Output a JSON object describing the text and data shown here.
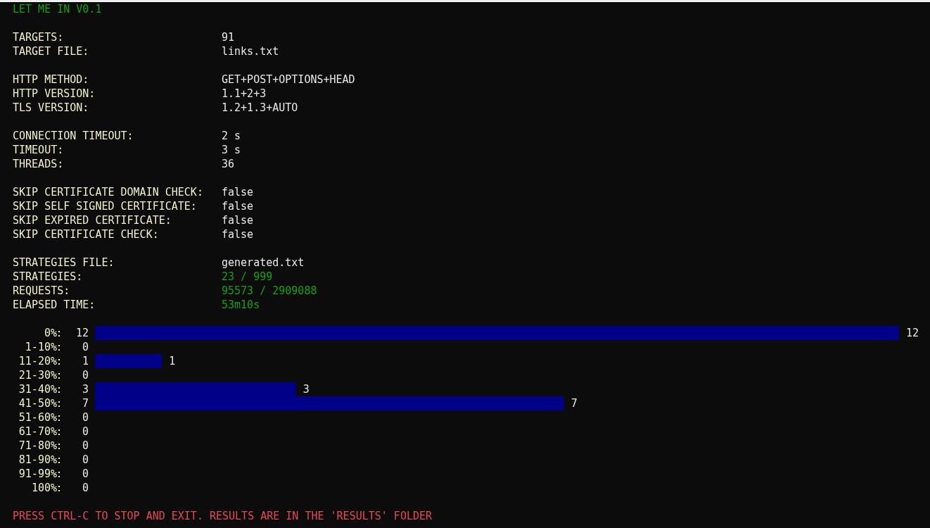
{
  "title": "LET ME IN V0.1",
  "setting_groups": [
    [
      {
        "label": "TARGETS:",
        "value": "91",
        "highlighted": false
      },
      {
        "label": "TARGET FILE:",
        "value": "links.txt",
        "highlighted": false
      }
    ],
    [
      {
        "label": "HTTP METHOD:",
        "value": "GET+POST+OPTIONS+HEAD",
        "highlighted": false
      },
      {
        "label": "HTTP VERSION:",
        "value": "1.1+2+3",
        "highlighted": false
      },
      {
        "label": "TLS VERSION:",
        "value": "1.2+1.3+AUTO",
        "highlighted": false
      }
    ],
    [
      {
        "label": "CONNECTION TIMEOUT:",
        "value": "2 s",
        "highlighted": false
      },
      {
        "label": "TIMEOUT:",
        "value": "3 s",
        "highlighted": false
      },
      {
        "label": "THREADS:",
        "value": "36",
        "highlighted": false
      }
    ],
    [
      {
        "label": "SKIP CERTIFICATE DOMAIN CHECK:",
        "value": "false",
        "highlighted": false
      },
      {
        "label": "SKIP SELF SIGNED CERTIFICATE:",
        "value": "false",
        "highlighted": false
      },
      {
        "label": "SKIP EXPIRED CERTIFICATE:",
        "value": "false",
        "highlighted": false
      },
      {
        "label": "SKIP CERTIFICATE CHECK:",
        "value": "false",
        "highlighted": false
      }
    ],
    [
      {
        "label": "STRATEGIES FILE:",
        "value": "generated.txt",
        "highlighted": false
      },
      {
        "label": "STRATEGIES:",
        "value": "23 / 999",
        "highlighted": true
      },
      {
        "label": "REQUESTS:",
        "value": "95573 / 2909088",
        "highlighted": true
      },
      {
        "label": "ELAPSED TIME:",
        "value": "53m10s",
        "highlighted": true
      }
    ]
  ],
  "histogram": {
    "counts": [
      "12",
      "0",
      "1",
      "0",
      "3",
      "7",
      "0",
      "0",
      "0",
      "0",
      "0",
      "0"
    ],
    "chart_data": {
      "type": "bar",
      "orientation": "horizontal",
      "categories": [
        "0%",
        "1-10%",
        "11-20%",
        "21-30%",
        "31-40%",
        "41-50%",
        "51-60%",
        "61-70%",
        "71-80%",
        "81-90%",
        "91-99%",
        "100%"
      ],
      "values": [
        12,
        0,
        1,
        0,
        3,
        7,
        0,
        0,
        0,
        0,
        0,
        0
      ],
      "value_labels": [
        "12",
        null,
        "1",
        null,
        "3",
        "7",
        null,
        null,
        null,
        null,
        null,
        null
      ]
    }
  },
  "footer": "PRESS CTRL-C TO STOP AND EXIT. RESULTS ARE IN THE 'RESULTS' FOLDER"
}
